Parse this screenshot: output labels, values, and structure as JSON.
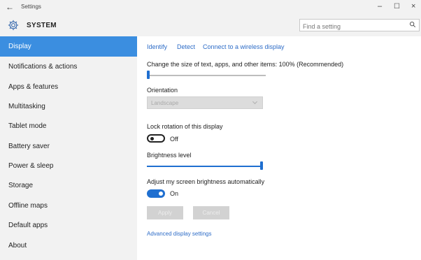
{
  "titlebar": {
    "back_glyph": "←",
    "title": "Settings",
    "min_glyph": "–",
    "max_glyph": "☐",
    "close_glyph": "×"
  },
  "header": {
    "icon": "gear-icon",
    "title": "SYSTEM",
    "search_placeholder": "Find a setting"
  },
  "sidebar": {
    "active_index": 0,
    "items": [
      {
        "label": "Display"
      },
      {
        "label": "Notifications & actions"
      },
      {
        "label": "Apps & features"
      },
      {
        "label": "Multitasking"
      },
      {
        "label": "Tablet mode"
      },
      {
        "label": "Battery saver"
      },
      {
        "label": "Power & sleep"
      },
      {
        "label": "Storage"
      },
      {
        "label": "Offline maps"
      },
      {
        "label": "Default apps"
      },
      {
        "label": "About"
      }
    ]
  },
  "display": {
    "links": {
      "identify": "Identify",
      "detect": "Detect",
      "wireless": "Connect to a wireless display"
    },
    "scale_label": "Change the size of text, apps, and other items: 100% (Recommended)",
    "scale_slider_value": 0,
    "orientation_label": "Orientation",
    "orientation_value": "Landscape",
    "lock_rotation_label": "Lock rotation of this display",
    "lock_rotation_state": "Off",
    "brightness_label": "Brightness level",
    "brightness_value": 1.0,
    "auto_brightness_label": "Adjust my screen brightness automatically",
    "auto_brightness_state": "On",
    "apply_label": "Apply",
    "cancel_label": "Cancel",
    "advanced_link": "Advanced display settings"
  },
  "colors": {
    "accent": "#1f6fd0",
    "active_nav": "#3b8ee0",
    "link": "#2d6cc7"
  }
}
